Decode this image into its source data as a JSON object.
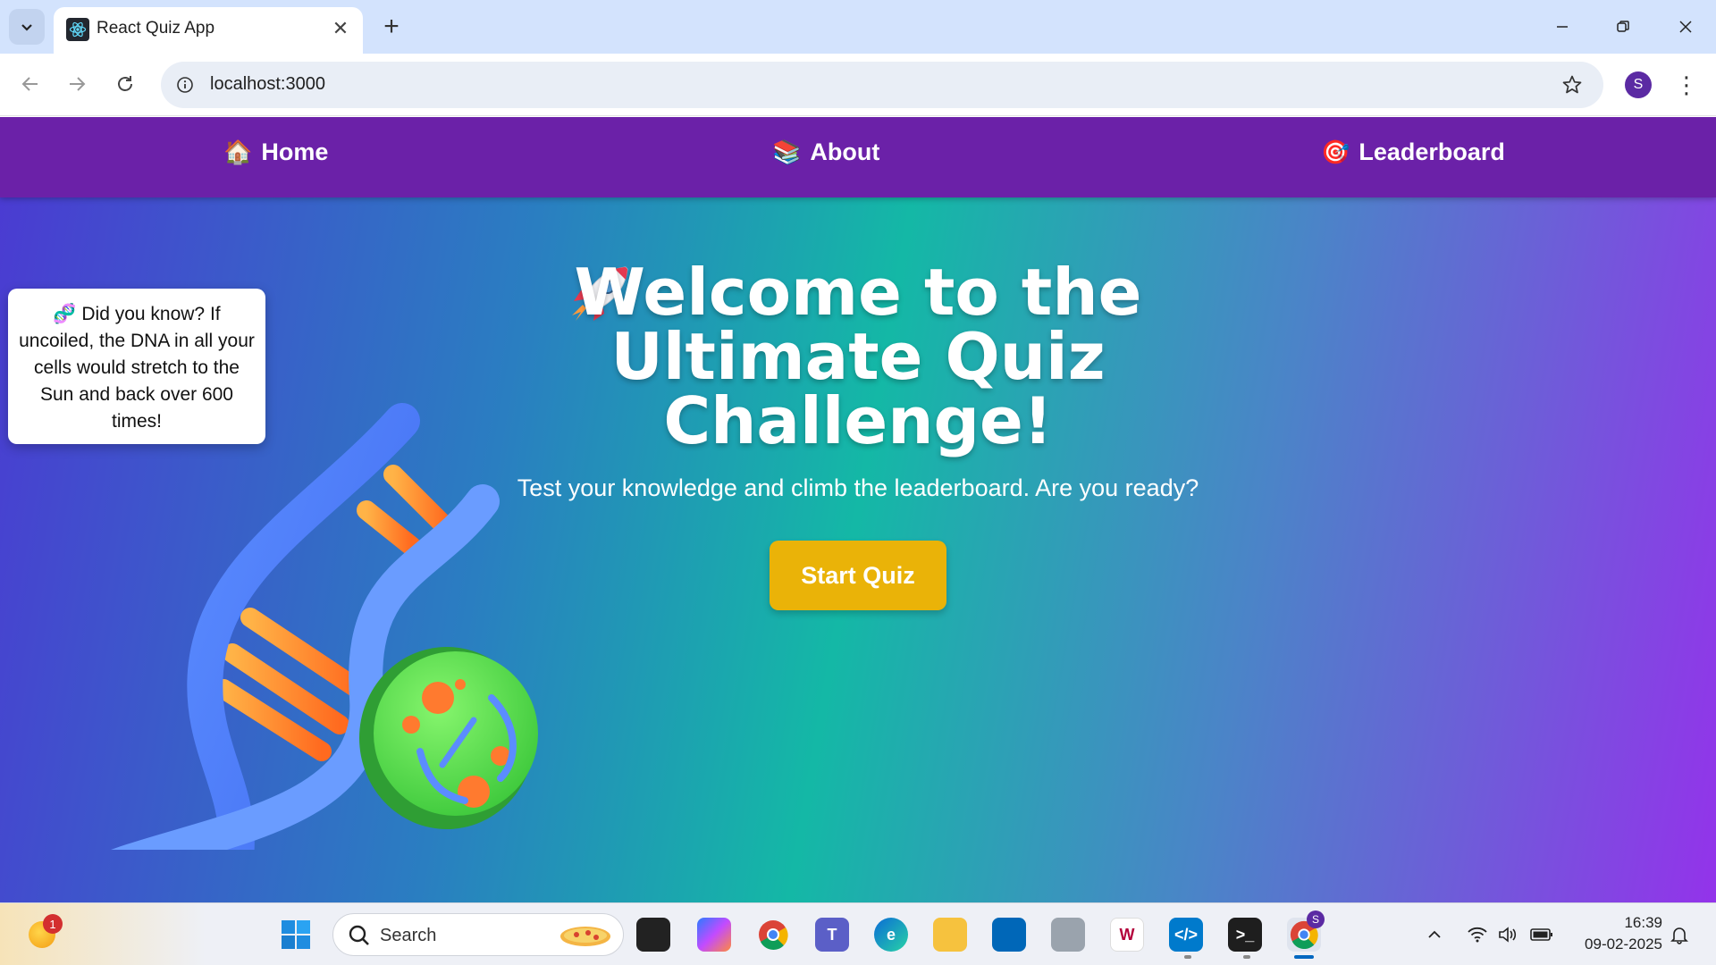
{
  "browser": {
    "tab_title": "React Quiz App",
    "url": "localhost:3000",
    "profile_initial": "S"
  },
  "nav": {
    "items": [
      {
        "emoji": "🏠",
        "label": "Home"
      },
      {
        "emoji": "📚",
        "label": "About"
      },
      {
        "emoji": "🎯",
        "label": "Leaderboard"
      }
    ]
  },
  "fact": {
    "emoji": "🧬",
    "text": "Did you know? If uncoiled, the DNA in all your cells would stretch to the Sun and back over 600 times!"
  },
  "hero": {
    "title": "Welcome to the Ultimate Quiz Challenge!",
    "subtitle": "Test your knowledge and climb the leaderboard. Are you ready?",
    "cta": "Start Quiz"
  },
  "taskbar": {
    "weather_badge": "1",
    "search_placeholder": "Search",
    "time": "16:39",
    "date": "09-02-2025",
    "chrome_badge": "S"
  },
  "colors": {
    "navbar": "#6b21a8",
    "cta": "#eab308",
    "gradient_left": "#4b3ad2",
    "gradient_mid": "#14b8a6",
    "gradient_right": "#9333ea"
  }
}
